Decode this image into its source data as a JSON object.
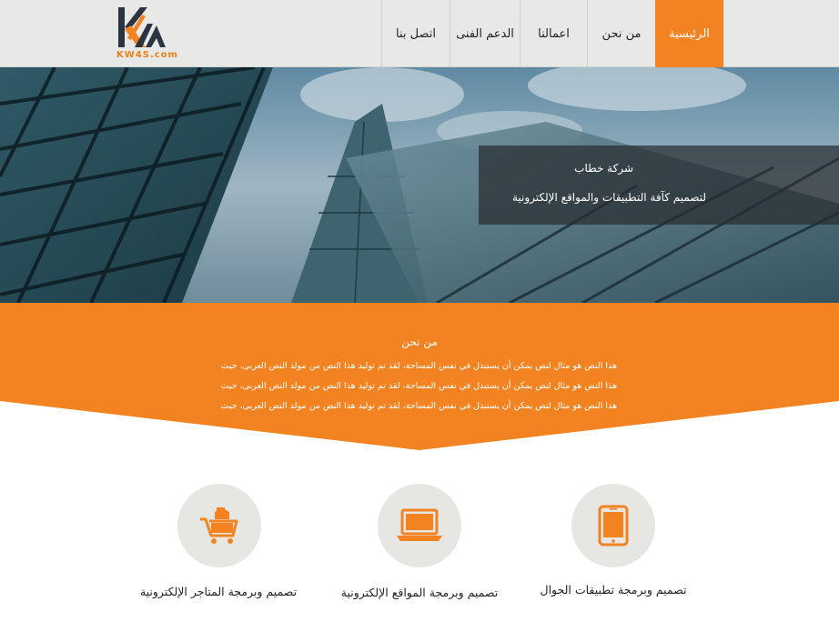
{
  "header": {
    "logo_text": "KW4S.com",
    "nav": [
      {
        "label": "الرئيسية",
        "active": true
      },
      {
        "label": "من نحن",
        "active": false
      },
      {
        "label": "اعمالنا",
        "active": false
      },
      {
        "label": "الدعم الفنى",
        "active": false
      },
      {
        "label": "اتصل بنا",
        "active": false
      }
    ]
  },
  "hero": {
    "title": "شركة خطاب",
    "subtitle": "لتصميم كآفة التطبيقات والمواقع الإلكترونية"
  },
  "about": {
    "title": "من نحن",
    "lines": [
      "هذا النص هو مثال لنص يمكن أن يستبدل في نفس المساحة، لقد تم توليد هذا النص من مولد النص العربى، حيث",
      "هذا النص هو مثال لنص يمكن أن يستبدل في نفس المساحة، لقد تم توليد هذا النص من مولد النص العربى، حيث",
      "هذا النص هو مثال لنص يمكن أن يستبدل في نفس المساحة، لقد تم توليد هذا النص من مولد النص العربى، حيث"
    ]
  },
  "services": [
    {
      "label": "تصميم وبرمجة تطبيقات الجوال",
      "icon": "tablet-icon"
    },
    {
      "label": "تصميم وبرمجة المواقع الإلكترونية",
      "icon": "laptop-icon"
    },
    {
      "label": "تصميم وبرمجة المتاجر الإلكترونية",
      "icon": "cart-icon"
    }
  ],
  "colors": {
    "accent": "#f38320",
    "header_bg": "#e8e9e6",
    "icon_circle": "#e6e6e3"
  }
}
